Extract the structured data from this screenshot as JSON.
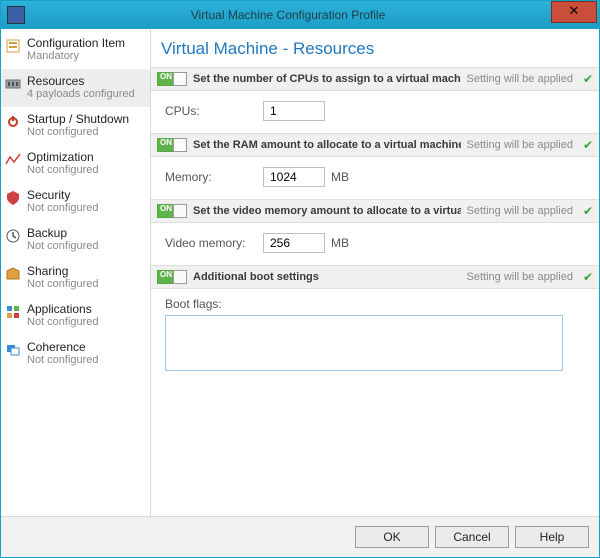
{
  "titlebar": {
    "title": "Virtual Machine Configuration Profile",
    "close_glyph": "✕"
  },
  "sidebar": {
    "items": [
      {
        "label": "Configuration Item",
        "sub": "Mandatory"
      },
      {
        "label": "Resources",
        "sub": "4 payloads configured"
      },
      {
        "label": "Startup / Shutdown",
        "sub": "Not configured"
      },
      {
        "label": "Optimization",
        "sub": "Not configured"
      },
      {
        "label": "Security",
        "sub": "Not configured"
      },
      {
        "label": "Backup",
        "sub": "Not configured"
      },
      {
        "label": "Sharing",
        "sub": "Not configured"
      },
      {
        "label": "Applications",
        "sub": "Not configured"
      },
      {
        "label": "Coherence",
        "sub": "Not configured"
      }
    ]
  },
  "main": {
    "title": "Virtual Machine - Resources",
    "status_text": "Setting will be applied",
    "toggle_on_text": "ON",
    "check_glyph": "✔",
    "sections": {
      "cpu": {
        "title": "Set the number of CPUs to assign to a virtual machine",
        "label": "CPUs:",
        "value": "1",
        "unit": ""
      },
      "ram": {
        "title": "Set the RAM amount to allocate to a virtual machine",
        "label": "Memory:",
        "value": "1024",
        "unit": "MB"
      },
      "video": {
        "title": "Set the video memory amount to allocate to a virtual machine",
        "label": "Video memory:",
        "value": "256",
        "unit": "MB"
      },
      "boot": {
        "title": "Additional boot settings",
        "label": "Boot flags:",
        "value": ""
      }
    }
  },
  "footer": {
    "ok": "OK",
    "cancel": "Cancel",
    "help": "Help"
  }
}
